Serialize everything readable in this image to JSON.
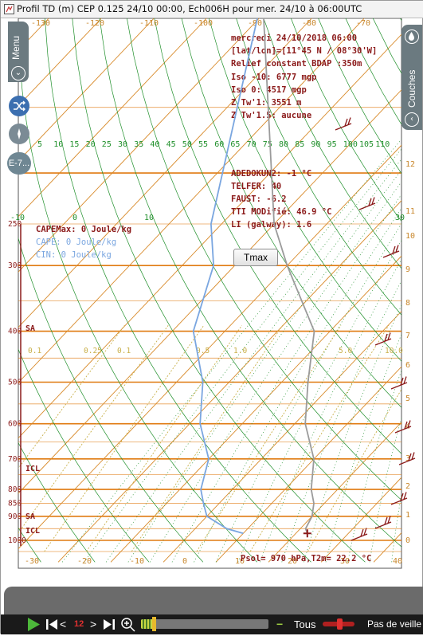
{
  "window": {
    "title": "Profil TD  (m) CEP 0.125 24/10 00:00, Ech006H pour mer. 24/10 à 06:00UTC"
  },
  "overlay": {
    "menu_label": "Menu",
    "couches_label": "Couches",
    "ech_button": "E-7...",
    "tmax_button": "Tmax"
  },
  "info_text": {
    "date_line": "mercredi 24/10/2018 06:00",
    "coords_line": "[lat/lon]=[11°45 N / 08°30'W]",
    "relief_line": "Relief constant BDAP :350m",
    "iso_m10": "Iso -10: 6777 mgp",
    "iso_0": "Iso 0: 4517 mgp",
    "ztw1": "Z Tw'1: 3551 m",
    "ztw15": "Z Tw'1.5: aucune",
    "adedokun": "ADEDOKUN2: -1 °C",
    "telfer": "TELFER: 40",
    "faust": "FAUST: -6.2",
    "tti": "TTI MODifié: 46.9 °C",
    "li": "LI (galway): 1.6",
    "capemax": "CAPEMax: 0 Joule/kg",
    "cape": "CAPE: 0 Joule/kg",
    "cin": "CIN: 0 Joule/kg",
    "psol": "Psol= 970 hPa,T2m= 22.2 °C"
  },
  "controls": {
    "play": "▶",
    "first": "|◀",
    "prev": "<",
    "step": "12",
    "next": ">",
    "last": "▶|",
    "zoom": "⊕",
    "minus": "−",
    "tous": "Tous",
    "veille": "Pas de veille",
    "timeline_progress": 0.1
  },
  "colors": {
    "isobar": "#e07a10",
    "isotherm": "#d88a2a",
    "dry_adiabat": "#1f8f2a",
    "moist_adiabat": "#1f8f2a",
    "mixing_ratio": "#c9b04a",
    "text_info": "#8b1a1a",
    "temp_curve": "#9b9b9b",
    "dewpoint_curve": "#7aa6e0",
    "wind_barb": "#8b1a1a",
    "tab_gray": "#6b7a80"
  },
  "chart_data": {
    "type": "line",
    "title": "",
    "xlabel": "",
    "ylabel": "",
    "pressure_levels_hPa": [
      250,
      300,
      400,
      500,
      600,
      700,
      800,
      850,
      900,
      1000
    ],
    "temperature_ticks_bottom": [
      -30,
      -20,
      -10,
      0,
      10,
      20,
      30,
      40
    ],
    "temperature_ticks_top": [
      -130,
      -120,
      -110,
      -100,
      -90,
      -80,
      -70
    ],
    "temperature_ticks_mid": [
      -10,
      0,
      10,
      20,
      30
    ],
    "mixing_ratio_labels": [
      "0.1",
      "0.25",
      "0.1",
      "0.5",
      "1.0",
      "5.0",
      "10.0"
    ],
    "potential_temp_labels": [
      "5",
      "10",
      "15",
      "20",
      "25",
      "30",
      "35",
      "40",
      "45",
      "50",
      "55",
      "60",
      "65",
      "70",
      "75",
      "80",
      "85",
      "90",
      "95",
      "100",
      "105",
      "110"
    ],
    "height_km_labels": [
      "13",
      "12",
      "11",
      "10",
      "9",
      "8",
      "7",
      "6",
      "5",
      "4",
      "3",
      "2",
      "1",
      "0"
    ],
    "level_markers": [
      {
        "label": "SA",
        "p": 400
      },
      {
        "label": "ICL",
        "p": 700
      },
      {
        "label": "SA",
        "p": 900
      },
      {
        "label": "ICL",
        "p": 950
      }
    ],
    "series": [
      {
        "name": "",
        "p_hPa": [
          250,
          300,
          400,
          500,
          600,
          700,
          800,
          850,
          900,
          950,
          970
        ],
        "values": [
          -40,
          -30,
          -13,
          -5,
          2,
          10,
          15,
          18,
          20,
          21,
          22.2
        ]
      },
      {
        "name": "",
        "p_hPa": [
          250,
          300,
          400,
          500,
          600,
          700,
          800,
          850,
          900,
          950,
          970
        ],
        "values": [
          -52,
          -44,
          -36,
          -25,
          -18,
          -10,
          -6,
          -3,
          0,
          6,
          10
        ]
      }
    ]
  }
}
